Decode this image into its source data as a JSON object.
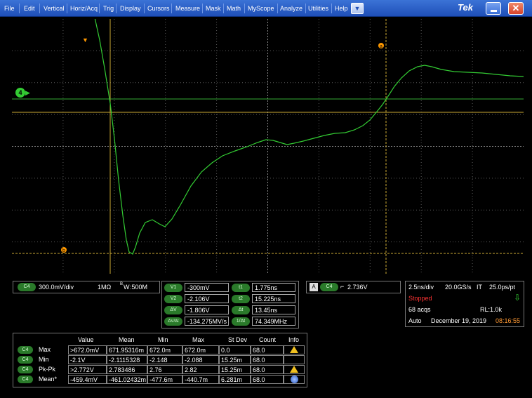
{
  "menu": {
    "items": [
      "File",
      "Edit",
      "Vertical",
      "Horiz/Acq",
      "Trig",
      "Display",
      "Cursors",
      "Measure",
      "Mask",
      "Math",
      "MyScope",
      "Analyze",
      "Utilities",
      "Help"
    ],
    "more_symbol": "▼",
    "brand": "Tek",
    "close_symbol": "✕"
  },
  "plot": {
    "channel_marker": "4",
    "cursor_a_label": "a",
    "cursor_b_label": "b",
    "colors": {
      "trace": "#33cc33",
      "cursor": "#ccaa33",
      "grid": "#5a5a5a",
      "trigger": "#ff9900"
    }
  },
  "channel": {
    "badge": "C4",
    "scale": "300.0mV/div",
    "coupling": "1MΩ",
    "bw_label": "W",
    "bw_value": ":500M"
  },
  "cursors": {
    "v1_label": "V1",
    "v1": "-300mV",
    "v2_label": "V2",
    "v2": "-2.106V",
    "dv_label": "ΔV",
    "dv": "-1.806V",
    "dvdt_label": "ΔV/Δt",
    "dvdt": "-134.275MV/s",
    "t1_label": "t1",
    "t1": "1.775ns",
    "t2_label": "t2",
    "t2": "15.225ns",
    "dt_label": "Δt",
    "dt": "13.45ns",
    "inv_dt_label": "1/Δt",
    "inv_dt": "74.349MHz"
  },
  "trigger": {
    "mode_badge": "A",
    "source_badge": "C4",
    "slope_symbol": "⌐",
    "level": "2.736V"
  },
  "timebase": {
    "scale": "2.5ns/div",
    "sample_rate": "20.0GS/s",
    "mode": "IT",
    "resolution": "25.0ps/pt",
    "state": "Stopped",
    "acqs": "68 acqs",
    "record_length": "RL:1.0k",
    "run_mode": "Auto",
    "date": "December 19, 2019",
    "time": "08:16:55"
  },
  "measurements": {
    "headers": [
      "Value",
      "Mean",
      "Min",
      "Max",
      "St Dev",
      "Count",
      "Info"
    ],
    "rows": [
      {
        "badge": "C4",
        "name": "Max",
        "value": ">672.0mV",
        "mean": "671.95316m",
        "min": "672.0m",
        "max": "672.0m",
        "stdev": "0.0",
        "count": "68.0",
        "info": "warning"
      },
      {
        "badge": "C4",
        "name": "Min",
        "value": "-2.1V",
        "mean": "-2.1115328",
        "min": "-2.148",
        "max": "-2.088",
        "stdev": "15.25m",
        "count": "68.0",
        "info": ""
      },
      {
        "badge": "C4",
        "name": "Pk-Pk",
        "value": ">2.772V",
        "mean": "2.783486",
        "min": "2.76",
        "max": "2.82",
        "stdev": "15.25m",
        "count": "68.0",
        "info": "warning"
      },
      {
        "badge": "C4",
        "name": "Mean*",
        "value": "-459.4mV",
        "mean": "-461.02432m",
        "min": "-477.6m",
        "max": "-440.7m",
        "stdev": "6.281m",
        "count": "68.0",
        "info": "info"
      }
    ]
  }
}
